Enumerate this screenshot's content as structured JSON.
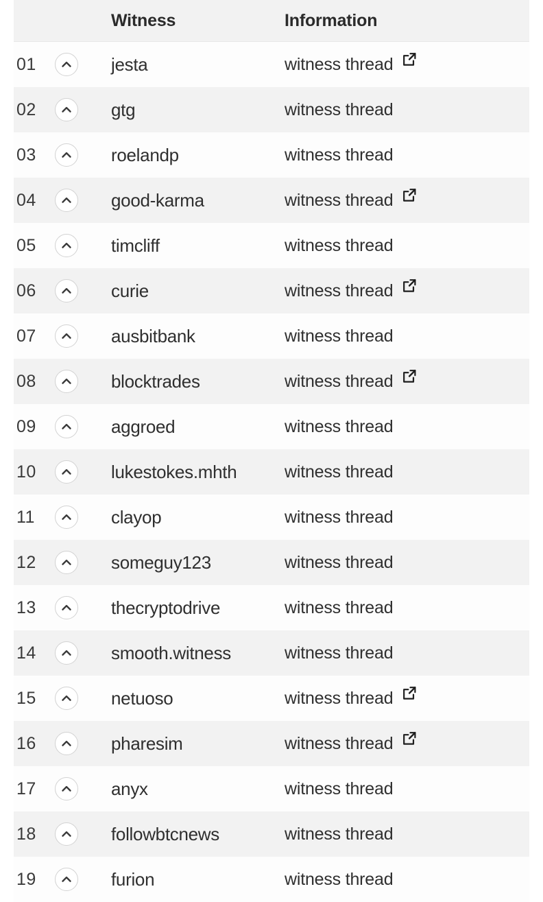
{
  "table": {
    "columns": {
      "rank_header": "",
      "vote_header": "",
      "witness_header": "Witness",
      "information_header": "Information"
    },
    "info_link_label": "witness thread",
    "icons": {
      "upvote": "chevron-up-circle-icon",
      "share": "external-link-icon"
    },
    "colors": {
      "header_bg": "#f2f2f2",
      "row_bg_odd": "#fdfdfd",
      "row_bg_even": "#f2f2f2",
      "text": "#2f2f2f",
      "header_text": "#2b2b2b",
      "upvote_border": "#d2d2d2"
    },
    "rows": [
      {
        "rank": "01",
        "witness": "jesta",
        "information": "witness thread",
        "has_share": true
      },
      {
        "rank": "02",
        "witness": "gtg",
        "information": "witness thread",
        "has_share": false
      },
      {
        "rank": "03",
        "witness": "roelandp",
        "information": "witness thread",
        "has_share": false
      },
      {
        "rank": "04",
        "witness": "good-karma",
        "information": "witness thread",
        "has_share": true
      },
      {
        "rank": "05",
        "witness": "timcliff",
        "information": "witness thread",
        "has_share": false
      },
      {
        "rank": "06",
        "witness": "curie",
        "information": "witness thread",
        "has_share": true
      },
      {
        "rank": "07",
        "witness": "ausbitbank",
        "information": "witness thread",
        "has_share": false
      },
      {
        "rank": "08",
        "witness": "blocktrades",
        "information": "witness thread",
        "has_share": true
      },
      {
        "rank": "09",
        "witness": "aggroed",
        "information": "witness thread",
        "has_share": false
      },
      {
        "rank": "10",
        "witness": "lukestokes.mhth",
        "information": "witness thread",
        "has_share": false
      },
      {
        "rank": "11",
        "witness": "clayop",
        "information": "witness thread",
        "has_share": false
      },
      {
        "rank": "12",
        "witness": "someguy123",
        "information": "witness thread",
        "has_share": false
      },
      {
        "rank": "13",
        "witness": "thecryptodrive",
        "information": "witness thread",
        "has_share": false
      },
      {
        "rank": "14",
        "witness": "smooth.witness",
        "information": "witness thread",
        "has_share": false
      },
      {
        "rank": "15",
        "witness": "netuoso",
        "information": "witness thread",
        "has_share": true
      },
      {
        "rank": "16",
        "witness": "pharesim",
        "information": "witness thread",
        "has_share": true
      },
      {
        "rank": "17",
        "witness": "anyx",
        "information": "witness thread",
        "has_share": false
      },
      {
        "rank": "18",
        "witness": "followbtcnews",
        "information": "witness thread",
        "has_share": false
      },
      {
        "rank": "19",
        "witness": "furion",
        "information": "witness thread",
        "has_share": false
      }
    ]
  }
}
